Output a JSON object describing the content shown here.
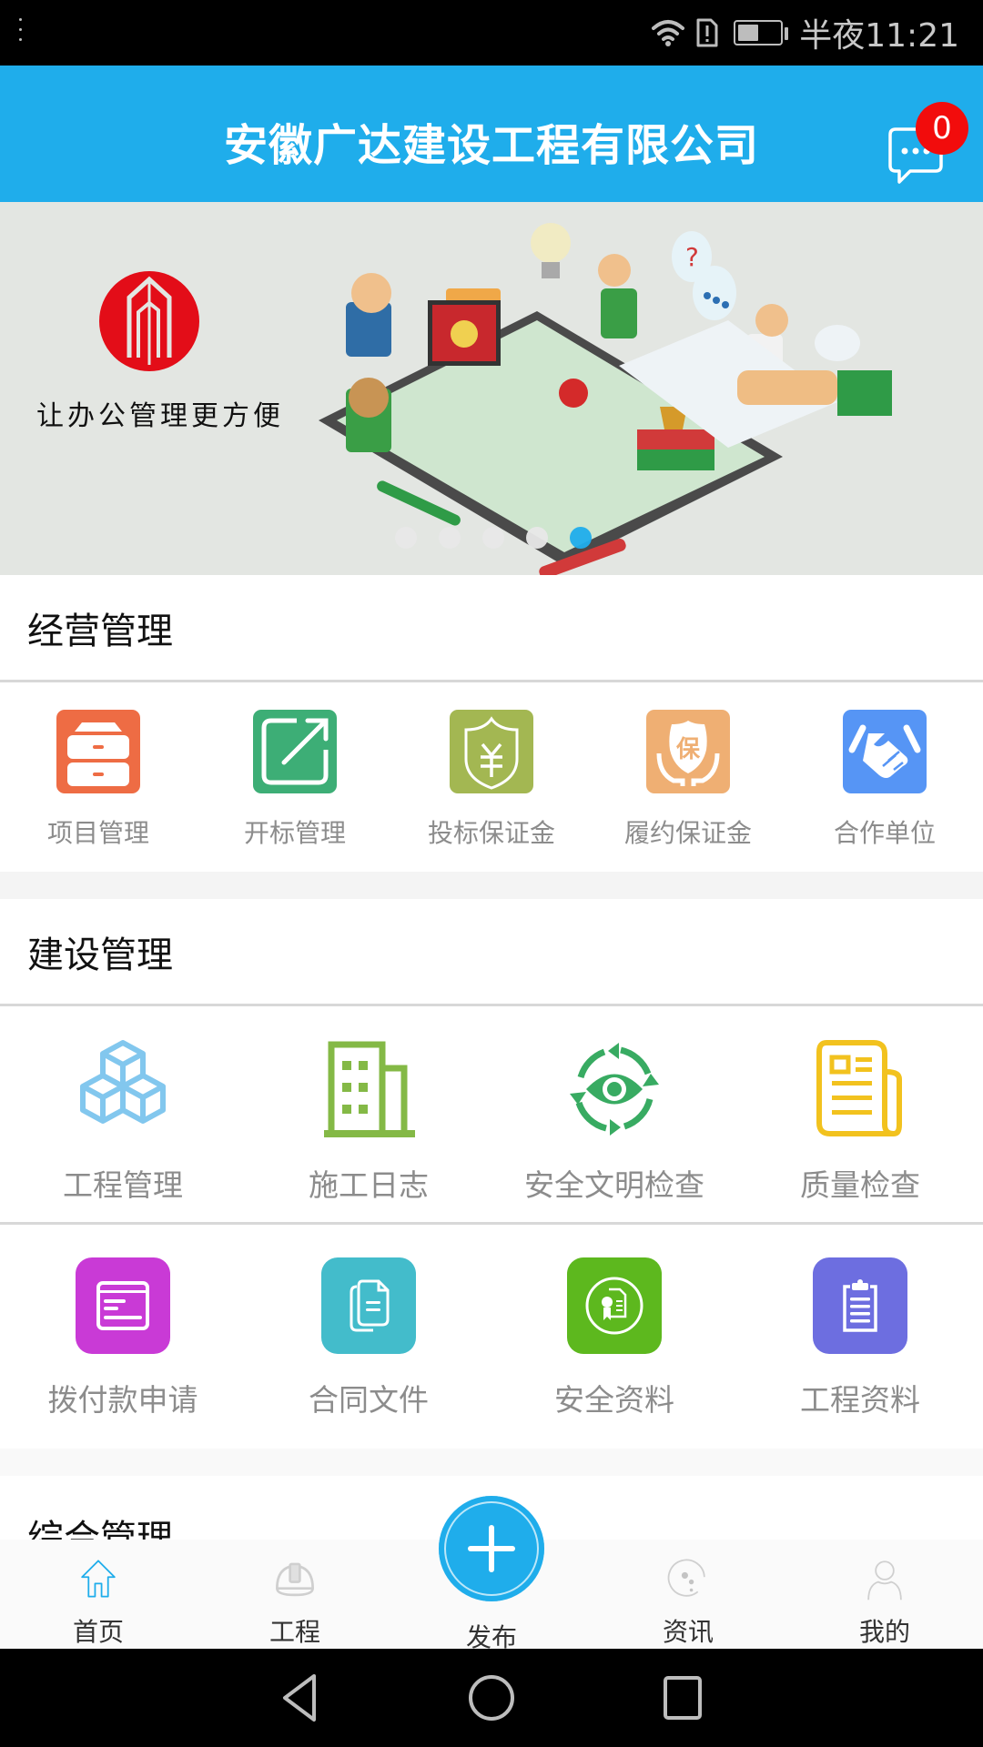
{
  "status_bar": {
    "time": "半夜11:21",
    "battery_level_percent": 50,
    "icons": [
      "wifi-icon",
      "sim-alert-icon",
      "battery-icon"
    ]
  },
  "header": {
    "title": "安徽广达建设工程有限公司",
    "message_badge_count": "0",
    "message_icon": "chat-bubble-icon"
  },
  "banner": {
    "slogan": "让办公管理更方便",
    "page_count": 5,
    "active_page": 5
  },
  "colors": {
    "accent": "#1fadeb",
    "badge": "#f20c0c"
  },
  "sections": [
    {
      "title": "经营管理",
      "items": [
        {
          "label": "项目管理",
          "icon": "cabinet-icon",
          "color": "#ee6c44"
        },
        {
          "label": "开标管理",
          "icon": "external-link-icon",
          "color": "#3dae76"
        },
        {
          "label": "投标保证金",
          "icon": "yuan-shield-icon",
          "color": "#a3b752"
        },
        {
          "label": "履约保证金",
          "icon": "hands-guarantee-icon",
          "color": "#efaf73"
        },
        {
          "label": "合作单位",
          "icon": "handshake-icon",
          "color": "#5695f5"
        }
      ]
    },
    {
      "title": "建设管理",
      "rows": [
        [
          {
            "label": "工程管理",
            "icon": "cubes-icon",
            "color": "#82c7ee"
          },
          {
            "label": "施工日志",
            "icon": "building-icon",
            "color": "#84b946"
          },
          {
            "label": "安全文明检查",
            "icon": "eye-cycle-icon",
            "color": "#38ab62"
          },
          {
            "label": "质量检查",
            "icon": "newspaper-icon",
            "color": "#f2c21e"
          }
        ],
        [
          {
            "label": "拨付款申请",
            "icon": "payment-form-icon",
            "color": "#c93ad6"
          },
          {
            "label": "合同文件",
            "icon": "documents-icon",
            "color": "#43bccb"
          },
          {
            "label": "安全资料",
            "icon": "certificate-icon",
            "color": "#5db81e"
          },
          {
            "label": "工程资料",
            "icon": "clipboard-icon",
            "color": "#6d6ee0"
          }
        ]
      ]
    },
    {
      "title": "综合管理"
    }
  ],
  "bottom_nav": {
    "items": [
      {
        "label": "首页",
        "icon": "home-icon",
        "active": true
      },
      {
        "label": "工程",
        "icon": "hard-hat-icon",
        "active": false
      },
      {
        "label": "发布",
        "icon": "plus-icon",
        "active": false
      },
      {
        "label": "资讯",
        "icon": "news-circle-icon",
        "active": false
      },
      {
        "label": "我的",
        "icon": "user-icon",
        "active": false
      }
    ]
  },
  "system_nav": {
    "icons": [
      "back-icon",
      "home-circle-icon",
      "recents-icon"
    ]
  }
}
